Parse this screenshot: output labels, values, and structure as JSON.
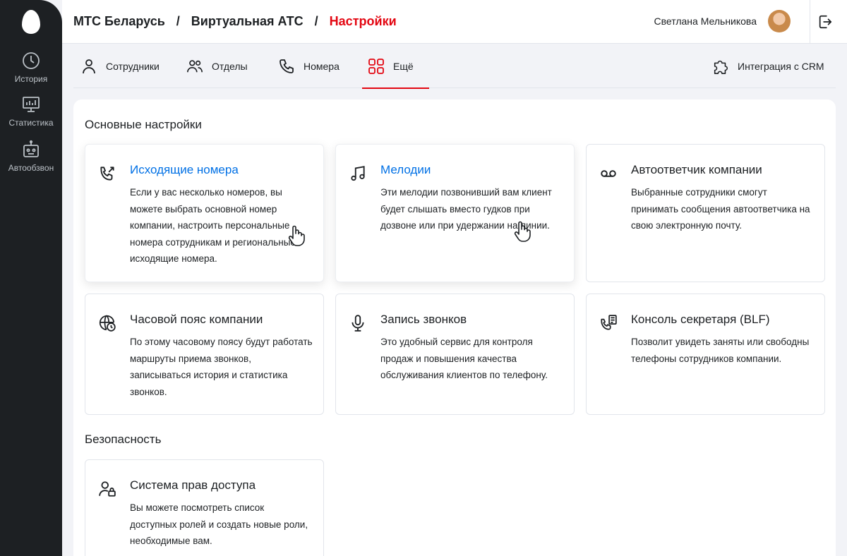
{
  "sidebar": {
    "items": [
      {
        "label": "История"
      },
      {
        "label": "Статистика"
      },
      {
        "label": "Автообзвон"
      }
    ]
  },
  "header": {
    "breadcrumbs": [
      "МТС Беларусь",
      "Виртуальная АТС",
      "Настройки"
    ],
    "user_name": "Светлана Мельникова"
  },
  "tabs": {
    "items": [
      {
        "label": "Сотрудники"
      },
      {
        "label": "Отделы"
      },
      {
        "label": "Номера"
      },
      {
        "label": "Ещё"
      }
    ],
    "crm_label": "Интеграция с CRM",
    "active": "Ещё"
  },
  "sections": [
    {
      "title": "Основные настройки",
      "cards": [
        {
          "title": "Исходящие номера",
          "text": "Если у вас несколько номеров, вы можете выбрать основной номер компании, настроить персональные номера сотрудникам и региональные исходящие номера."
        },
        {
          "title": "Мелодии",
          "text": "Эти мелодии позвонивший вам клиент будет слышать вместо гудков при дозвоне или при удержании на линии."
        },
        {
          "title": "Автоответчик компании",
          "text": "Выбранные сотрудники смогут принимать сообщения автоответчика на свою электронную почту."
        },
        {
          "title": "Часовой пояс компании",
          "text": "По этому часовому поясу будут работать маршруты приема звонков, записываться история и статистика звонков."
        },
        {
          "title": "Запись звонков",
          "text": "Это удобный сервис для контроля продаж и повышения качества обслуживания клиентов по телефону."
        },
        {
          "title": "Консоль секретаря (BLF)",
          "text": "Позволит увидеть заняты или свободны телефоны сотрудников компании."
        }
      ]
    },
    {
      "title": "Безопасность",
      "cards": [
        {
          "title": "Система прав доступа",
          "text": "Вы можете посмотреть список доступных ролей и создать новые роли, необходимые вам."
        }
      ]
    }
  ],
  "colors": {
    "brand_red": "#e30611",
    "link_blue": "#0070e5",
    "sidebar_bg": "#1d2023"
  },
  "icons": [
    "history-icon",
    "statistics-icon",
    "robot-icon",
    "logout-icon",
    "person-icon",
    "people-icon",
    "phone-icon",
    "grid-icon",
    "puzzle-icon",
    "phone-outgoing-icon",
    "music-note-icon",
    "voicemail-icon",
    "globe-clock-icon",
    "microphone-icon",
    "phone-list-icon",
    "user-lock-icon",
    "hand-cursor-icon"
  ]
}
